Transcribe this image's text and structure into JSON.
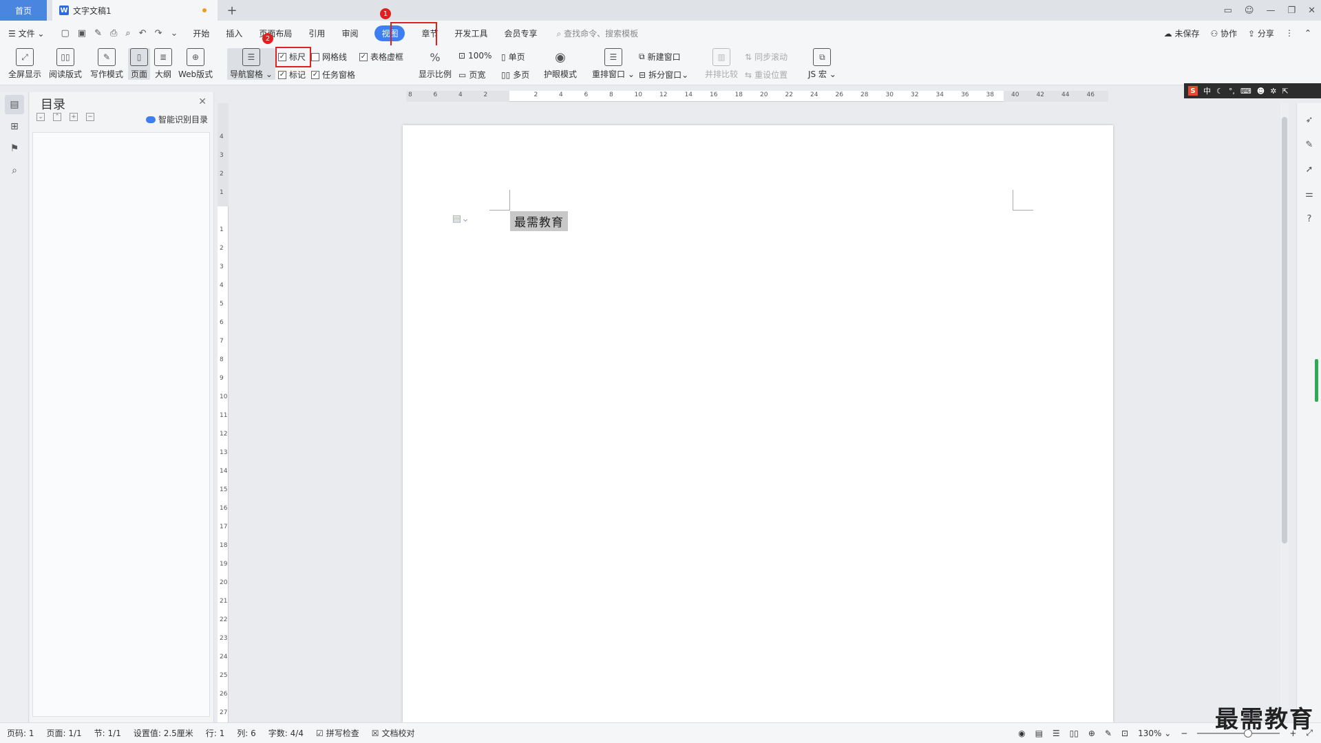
{
  "titlebar": {
    "home_tab": "首页",
    "doc_tab": "文字文稿1",
    "new_tab": "+",
    "controls": [
      "▭",
      "—",
      "❐",
      "✕"
    ]
  },
  "menu": {
    "file": "文件",
    "items": [
      "开始",
      "插入",
      "页面布局",
      "引用",
      "审阅",
      "视图",
      "章节",
      "开发工具",
      "会员专享"
    ],
    "active": "视图",
    "search_placeholder": "查找命令、搜索模板",
    "unsaved": "未保存",
    "collab": "协作",
    "share": "分享"
  },
  "ribbon": {
    "fullscreen": "全屏显示",
    "read_mode": "阅读版式",
    "write_mode": "写作模式",
    "page": "页面",
    "outline": "大纲",
    "web": "Web版式",
    "nav_pane": "导航窗格",
    "ruler": "标尺",
    "grid": "网格线",
    "table_frame": "表格虚框",
    "mark": "标记",
    "task_pane": "任务窗格",
    "zoom": "显示比例",
    "zoom100": "100%",
    "page_width": "页宽",
    "single_page": "单页",
    "multi_page": "多页",
    "eye_mode": "护眼模式",
    "arrange": "重排窗口",
    "new_window": "新建窗口",
    "split": "拆分窗口",
    "side_by_side": "并排比较",
    "sync_scroll": "同步滚动",
    "reset_pos": "重设位置",
    "js_macro": "JS 宏"
  },
  "annotations": {
    "badge1": "1",
    "badge2": "2"
  },
  "ime": {
    "logo": "S",
    "lang": "中"
  },
  "navpane": {
    "title": "目录",
    "smart": "智能识别目录"
  },
  "ruler": {
    "h_labels": [
      "8",
      "6",
      "4",
      "2",
      "",
      "2",
      "4",
      "6",
      "8",
      "10",
      "12",
      "14",
      "16",
      "18",
      "20",
      "22",
      "24",
      "26",
      "28",
      "30",
      "32",
      "34",
      "36",
      "38",
      "40",
      "42",
      "44",
      "46"
    ],
    "v_labels": [
      "4",
      "3",
      "2",
      "1",
      "",
      "1",
      "2",
      "3",
      "4",
      "5",
      "6",
      "7",
      "8",
      "9",
      "10",
      "11",
      "12",
      "13",
      "14",
      "15",
      "16",
      "17",
      "18",
      "19",
      "20",
      "21",
      "22",
      "23",
      "24",
      "25",
      "26",
      "27"
    ]
  },
  "document": {
    "text": "最需教育"
  },
  "status": {
    "page_code": "页码: 1",
    "page": "页面: 1/1",
    "section": "节: 1/1",
    "setting": "设置值: 2.5厘米",
    "row": "行: 1",
    "col": "列: 6",
    "words": "字数: 4/4",
    "spell": "拼写检查",
    "proof": "文档校对",
    "zoom": "130%"
  },
  "watermark": "最需教育"
}
